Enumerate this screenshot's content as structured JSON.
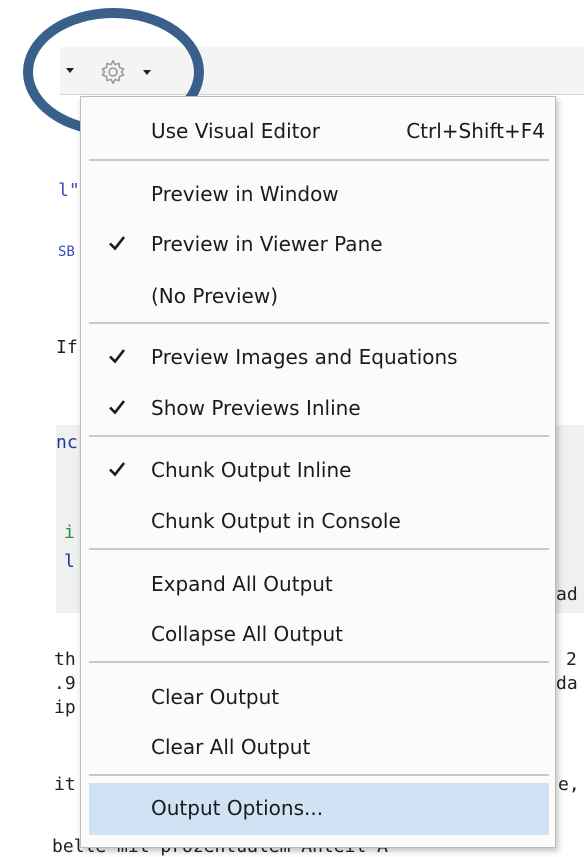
{
  "background": {
    "snippets": [
      "l\"",
      "SB",
      "If",
      "nc",
      "i",
      "l",
      "ad",
      "th",
      "2",
      ".9",
      "da",
      "ip",
      "it",
      "e,",
      "belle mit prozentualem Anteil A"
    ]
  },
  "toolbar": {
    "left_dropdown_icon": "chevron-down-icon",
    "settings_icon": "gear-icon",
    "settings_dropdown_icon": "chevron-down-icon"
  },
  "menu": {
    "items": [
      {
        "label": "Use Visual Editor",
        "shortcut": "Ctrl+Shift+F4",
        "checked": false
      },
      {
        "label": "Preview in Window",
        "checked": false
      },
      {
        "label": "Preview in Viewer Pane",
        "checked": true
      },
      {
        "label": "(No Preview)",
        "checked": false
      },
      {
        "label": "Preview Images and Equations",
        "checked": true
      },
      {
        "label": "Show Previews Inline",
        "checked": true
      },
      {
        "label": "Chunk Output Inline",
        "checked": true
      },
      {
        "label": "Chunk Output in Console",
        "checked": false
      },
      {
        "label": "Expand All Output",
        "checked": false
      },
      {
        "label": "Collapse All Output",
        "checked": false
      },
      {
        "label": "Clear Output",
        "checked": false
      },
      {
        "label": "Clear All Output",
        "checked": false
      },
      {
        "label": "Output Options...",
        "checked": false,
        "highlighted": true
      }
    ]
  },
  "colors": {
    "highlight_ring": "#3a5f8a",
    "selected_item": "#cfe3f5"
  }
}
